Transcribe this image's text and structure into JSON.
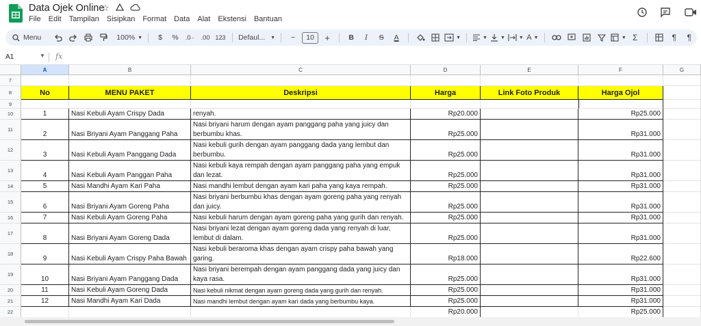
{
  "app": {
    "title": "Data Ojek Online",
    "menu": [
      "File",
      "Edit",
      "Tampilan",
      "Sisipkan",
      "Format",
      "Data",
      "Alat",
      "Ekstensi",
      "Bantuan"
    ]
  },
  "toolbar": {
    "menu_label": "Menu",
    "zoom": "100%",
    "currency": "$",
    "percent": "%",
    "dec_decrease": ".0",
    "dec_increase": ".00",
    "number_format": "123",
    "font": "Defaul...",
    "font_size": "10",
    "minus": "−",
    "plus": "+",
    "bold": "B",
    "italic": "I",
    "strike": "S",
    "text_color": "A",
    "sigma": "Σ"
  },
  "formula_bar": {
    "cell_ref": "A1",
    "fx": "fx"
  },
  "columns": [
    "A",
    "B",
    "C",
    "D",
    "E",
    "F",
    "G"
  ],
  "header_row": {
    "no": "No",
    "menu": "MENU PAKET",
    "desc": "Deskripsi",
    "harga": "Harga",
    "link": "Link Foto Produk",
    "ojol": "Harga Ojol"
  },
  "rows": [
    {
      "num": "10",
      "no": "1",
      "menu": "Nasi Kebuli Ayam Crispy Dada",
      "desc": "Nasi kebuli berempah dengan ayam crispy dada yang gurih dan renyah.",
      "harga": "Rp20.000",
      "ojol": "Rp25.000"
    },
    {
      "num": "11",
      "no": "2",
      "menu": "Nasi Briyani Ayam Panggang Paha",
      "desc": "Nasi briyani harum dengan ayam panggang paha yang juicy dan berbumbu khas.",
      "harga": "Rp25.000",
      "ojol": "Rp31.000"
    },
    {
      "num": "12",
      "no": "3",
      "menu": "Nasi Kebuli Ayam Panggang Dada",
      "desc": "Nasi kebuli gurih dengan ayam panggang dada yang lembut dan berbumbu.",
      "harga": "Rp25.000",
      "ojol": "Rp31.000"
    },
    {
      "num": "13",
      "no": "4",
      "menu": "Nasi Kebuli Ayam Panggan Paha",
      "desc": "Nasi kebuli kaya rempah dengan ayam panggang paha yang empuk dan lezat.",
      "harga": "Rp25.000",
      "ojol": "Rp31.000"
    },
    {
      "num": "14",
      "no": "5",
      "menu": "Nasi Mandhi Ayam Kari Paha",
      "desc": "Nasi mandhi lembut dengan ayam kari paha yang kaya rempah.",
      "harga": "Rp25.000",
      "ojol": "Rp31.000"
    },
    {
      "num": "15",
      "no": "6",
      "menu": "Nasi Briyani Ayam Goreng Paha",
      "desc": "Nasi briyani berbumbu khas dengan ayam goreng paha yang renyah dan juicy.",
      "harga": "Rp25.000",
      "ojol": "Rp31.000"
    },
    {
      "num": "16",
      "no": "7",
      "menu": "Nasi Kebuli Ayam Goreng Paha",
      "desc": "Nasi kebuli harum dengan ayam goreng paha yang gurih dan renyah.",
      "harga": "Rp25.000",
      "ojol": "Rp31.000"
    },
    {
      "num": "17",
      "no": "8",
      "menu": "Nasi Briyani Ayam Goreng Dada",
      "desc": "Nasi briyani lezat dengan ayam goreng dada yang renyah di luar, lembut di dalam.",
      "harga": "Rp25.000",
      "ojol": "Rp31.000"
    },
    {
      "num": "18",
      "no": "9",
      "menu": "Nasi Kebuli Ayam Crispy Paha Bawah",
      "desc": "Nasi kebuli beraroma khas dengan ayam crispy paha bawah yang garing.",
      "harga": "Rp18.000",
      "ojol": "Rp22.600"
    },
    {
      "num": "19",
      "no": "10",
      "menu": "Nasi Briyani Ayam Panggang Dada",
      "desc": "Nasi briyani berempah dengan ayam panggang dada yang juicy dan kaya rasa.",
      "harga": "Rp25.000",
      "ojol": "Rp31.000"
    },
    {
      "num": "20",
      "no": "11",
      "menu": "Nasi Kebuli Ayam Goreng Dada",
      "desc": " Nasi kebuli nikmat dengan ayam goreng dada yang gurih dan renyah.",
      "harga": "Rp25.000",
      "ojol": "Rp31.000"
    },
    {
      "num": "21",
      "no": "12",
      "menu": "Nasi Mandhi Ayam Kari Dada",
      "desc": "Nasi mandhi lembut dengan ayam kari dada yang berbumbu kaya.",
      "harga": "Rp25.000",
      "ojol": "Rp31.000"
    },
    {
      "num": "22",
      "no": "",
      "menu": "",
      "desc": "",
      "harga": "Rp20.000",
      "ojol": "Rp25.000"
    }
  ],
  "row_labels_top": [
    "7",
    "8",
    "9"
  ]
}
